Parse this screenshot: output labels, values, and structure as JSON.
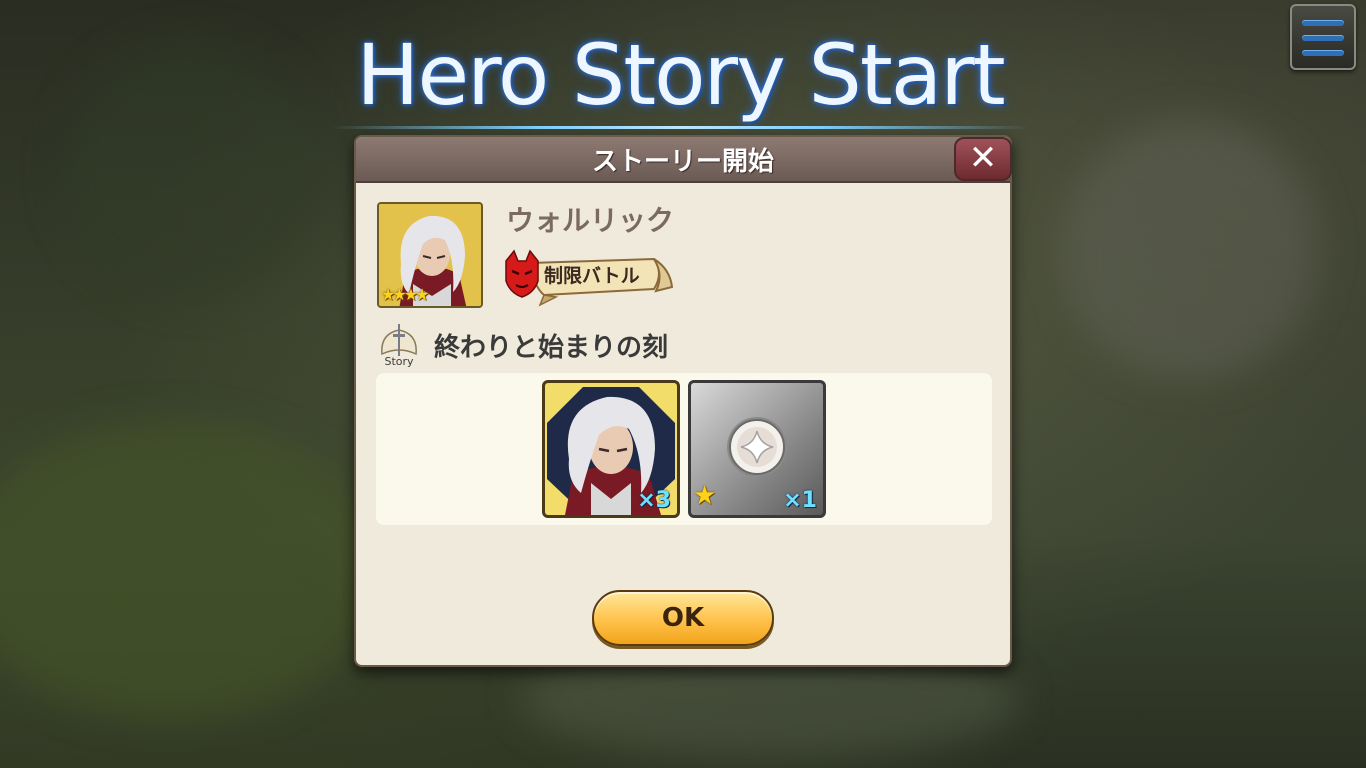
{
  "screen_title": "Hero Story Start",
  "dialog": {
    "title": "ストーリー開始",
    "close_icon": "close-icon",
    "hero": {
      "name": "ウォルリック",
      "rarity_stars": 4,
      "stars_text": "★★★★",
      "battle_badge": "制限バトル"
    },
    "story": {
      "icon_label": "Story",
      "title": "終わりと始まりの刻"
    },
    "rewards": [
      {
        "type": "hero",
        "quantity": "×3"
      },
      {
        "type": "item",
        "star": "★",
        "quantity": "×1"
      }
    ],
    "ok_label": "OK"
  },
  "colors": {
    "dialog_bg": "#efeadb",
    "header_bg": "#7a6660",
    "close_bg": "#8a3a42",
    "ok_bg": "#ffc24a",
    "qty_text": "#6fe0ff",
    "title_glow": "#2a64c0"
  }
}
